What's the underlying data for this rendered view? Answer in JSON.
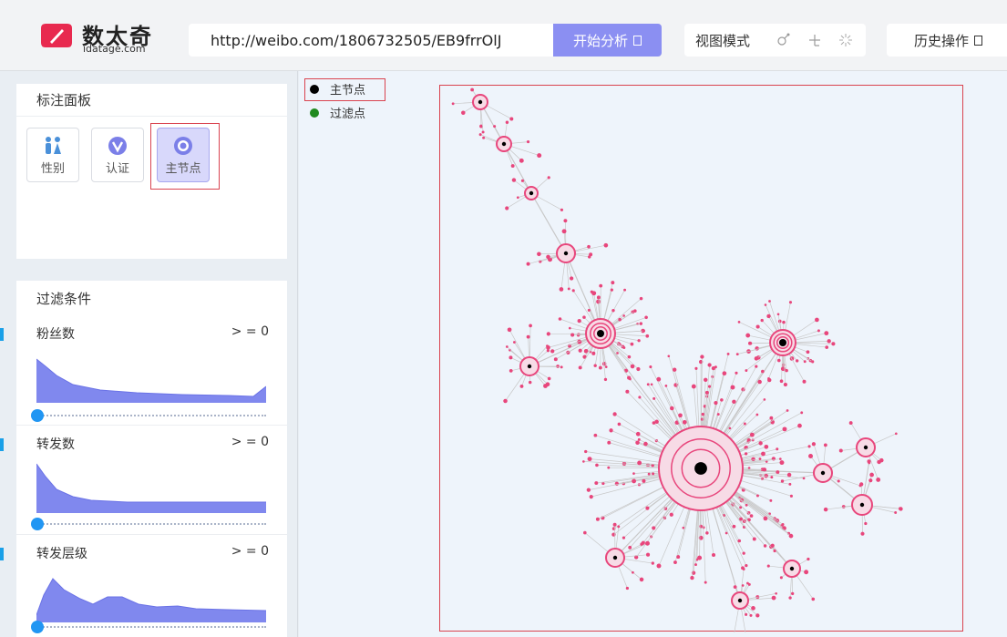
{
  "app": {
    "logo_title": "数太奇",
    "logo_sub": "idatage.com",
    "brand_color": "#e8294f"
  },
  "toolbar": {
    "url_value": "http://weibo.com/1806732505/EB9frrOlJ",
    "analyze_label": "开始分析",
    "view_mode_label": "视图模式",
    "view_icons": [
      "graph-link-icon",
      "tree-layout-icon",
      "radial-layout-icon"
    ],
    "history_label": "历史操作",
    "accent_color": "#8b8ff2"
  },
  "mark_panel": {
    "title": "标注面板",
    "buttons": [
      {
        "label": "性别",
        "icon": "gender-icon",
        "active": false
      },
      {
        "label": "认证",
        "icon": "verified-v-icon",
        "active": false
      },
      {
        "label": "主节点",
        "icon": "target-node-icon",
        "active": true
      }
    ]
  },
  "filter_panel": {
    "title": "过滤条件",
    "filters": [
      {
        "name": "粉丝数",
        "value": "> = 0",
        "slider": 0
      },
      {
        "name": "转发数",
        "value": "> = 0",
        "slider": 0
      },
      {
        "name": "转发层级",
        "value": "> = 0",
        "slider": 0
      }
    ]
  },
  "graph": {
    "legend": [
      {
        "label": "主节点",
        "color": "#000000"
      },
      {
        "label": "过滤点",
        "color": "#1f8a1f"
      }
    ],
    "node_color": "#e8467c",
    "edge_color": "#c8c8c8"
  }
}
